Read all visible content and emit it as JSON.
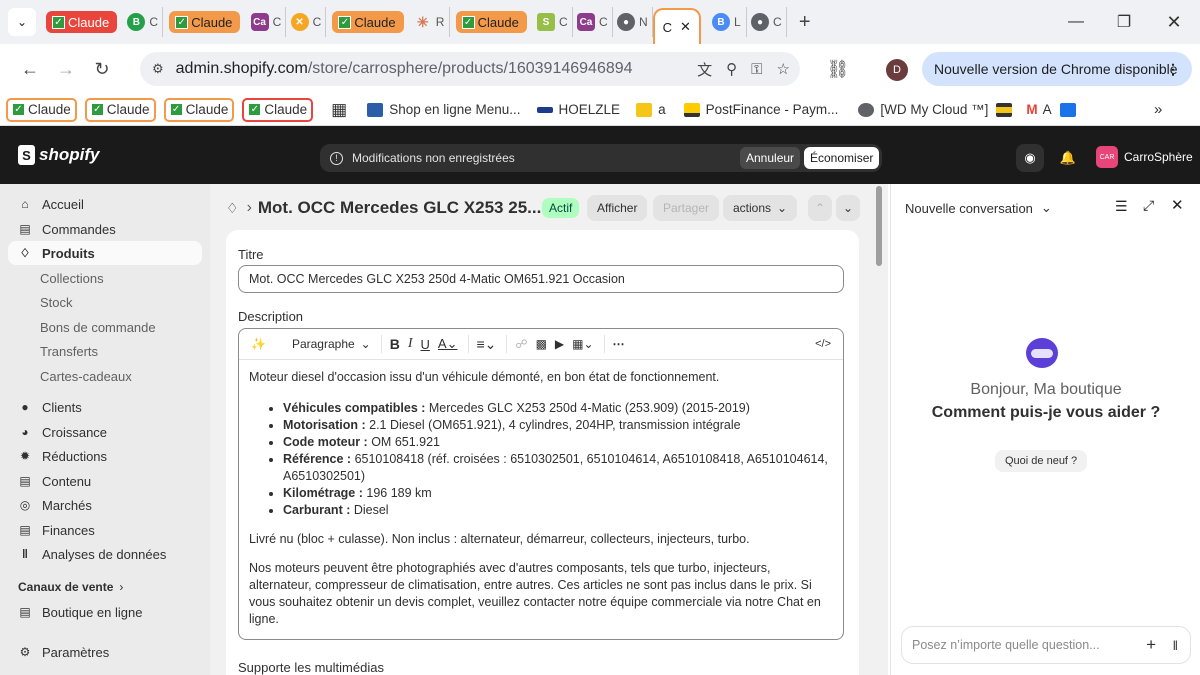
{
  "browser": {
    "tabs": {
      "claude": "Claude",
      "mini": [
        {
          "icon": "B",
          "letter": "C",
          "color": "#24a148"
        },
        {
          "icon": "Ca",
          "letter": "C",
          "color": "#8e3b8b"
        },
        {
          "icon": "✕",
          "letter": "C",
          "color": "#f5a623"
        },
        {
          "icon": "✳",
          "letter": "R",
          "color": "#d97757"
        },
        {
          "icon": "S",
          "letter": "C",
          "color": "#95bf47"
        },
        {
          "icon": "Ca",
          "letter": "C",
          "color": "#8e3b8b"
        },
        {
          "icon": "●",
          "letter": "N",
          "color": "#5f6368"
        }
      ],
      "active_letter": "C",
      "after": [
        {
          "icon": "B",
          "letter": "L",
          "color": "#4c8bf5"
        },
        {
          "icon": "●",
          "letter": "C",
          "color": "#5f6368"
        }
      ]
    },
    "url_host": "admin.shopify.com",
    "url_path": "/store/carrosphere/products/16039146946894",
    "profile_letter": "D",
    "update_text": "Nouvelle version de Chrome disponible",
    "bookmarks": {
      "claude": "Claude",
      "shop": "Shop en ligne Menu...",
      "hoelzle": "HOELZLE",
      "a": "a",
      "postfinance": "PostFinance - Paym...",
      "wd": "[WD My Cloud ™]",
      "ma": "A"
    }
  },
  "shopify": {
    "logo": "shopify",
    "unsaved": "Modifications non enregistrées",
    "cancel": "Annuleur",
    "save": "Économiser",
    "store_initials": "CAR",
    "store_name": "CarroSphère"
  },
  "nav": {
    "accueil": "Accueil",
    "commandes": "Commandes",
    "produits": "Produits",
    "collections": "Collections",
    "stock": "Stock",
    "bons": "Bons de commande",
    "transferts": "Transferts",
    "cartes": "Cartes-cadeaux",
    "clients": "Clients",
    "croissance": "Croissance",
    "reductions": "Réductions",
    "contenu": "Contenu",
    "marches": "Marchés",
    "finances": "Finances",
    "analyses": "Analyses de données",
    "canaux": "Canaux de vente",
    "boutique": "Boutique en ligne",
    "parametres": "Paramètres"
  },
  "product": {
    "heading": "Mot. OCC Mercedes GLC X253 25...",
    "status": "Actif",
    "view": "Afficher",
    "share": "Partager",
    "actions": "actions",
    "title_label": "Titre",
    "title_value": "Mot. OCC Mercedes GLC X253 250d 4-Matic OM651.921 Occasion",
    "description_label": "Description",
    "format": "Paragraphe",
    "intro": "Moteur diesel d'occasion issu d'un véhicule démonté, en bon état de fonctionnement.",
    "specs": [
      {
        "k": "Véhicules compatibles :",
        "v": " Mercedes GLC X253 250d 4-Matic (253.909) (2015-2019)"
      },
      {
        "k": "Motorisation :",
        "v": " 2.1 Diesel (OM651.921), 4 cylindres, 204HP, transmission intégrale"
      },
      {
        "k": "Code moteur :",
        "v": " OM 651.921"
      },
      {
        "k": "Référence :",
        "v": " 6510108418 (réf. croisées : 6510302501, 6510104614, A6510108418, A6510104614, A6510302501)"
      },
      {
        "k": "Kilométrage :",
        "v": " 196 189 km"
      },
      {
        "k": "Carburant :",
        "v": " Diesel"
      }
    ],
    "note": "Livré nu (bloc + culasse). Non inclus : alternateur, démarreur, collecteurs, injecteurs, turbo.",
    "disclaimer": "Nos moteurs peuvent être photographiés avec d'autres composants, tels que turbo, injecteurs, alternateur, compresseur de climatisation, entre autres. Ces articles ne sont pas inclus dans le prix. Si vous souhaitez obtenir un devis complet, veuillez contacter notre équipe commerciale via notre Chat en ligne.",
    "media_label": "Supporte les multimédias"
  },
  "assistant": {
    "title": "Nouvelle conversation",
    "greeting": "Bonjour, Ma boutique",
    "question": "Comment puis-je vous aider ?",
    "whats_new": "Quoi de neuf ?",
    "placeholder": "Posez n’importe quelle question..."
  }
}
